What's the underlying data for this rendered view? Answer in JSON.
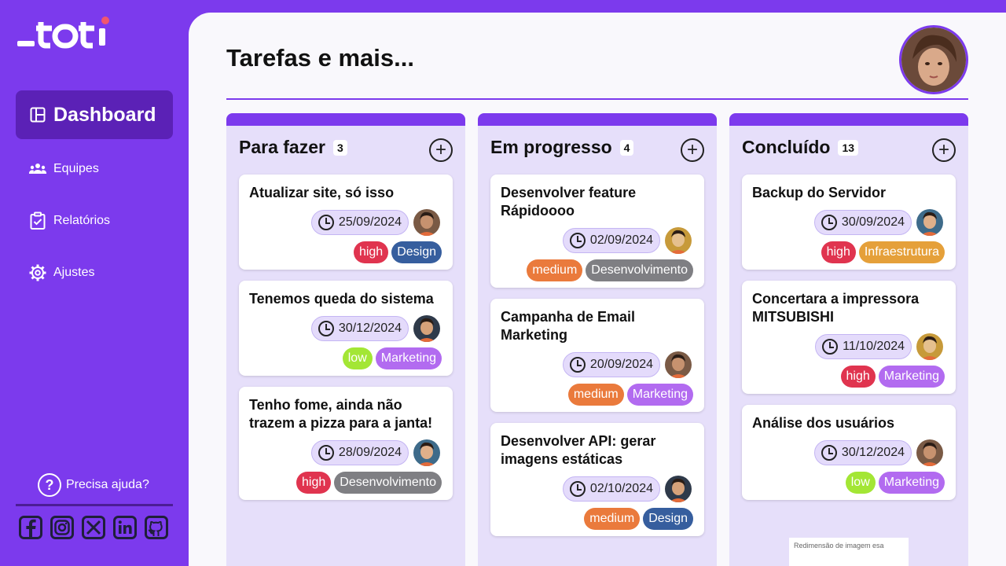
{
  "brand": {
    "logo_text": "_toti"
  },
  "sidebar": {
    "active": {
      "label": "Dashboard",
      "icon": "layout-icon"
    },
    "items": [
      {
        "label": "Equipes",
        "icon": "team-icon"
      },
      {
        "label": "Relatórios",
        "icon": "clipboard-check-icon"
      },
      {
        "label": "Ajustes",
        "icon": "gear-icon"
      }
    ],
    "help_label": "Precisa ajuda?",
    "socials": [
      "facebook-icon",
      "instagram-icon",
      "x-icon",
      "linkedin-icon",
      "github-icon"
    ]
  },
  "header": {
    "title": "Tarefas e mais..."
  },
  "colors": {
    "accent": "#7c3aed",
    "high": "#e0344f",
    "medium": "#ea7a3c",
    "low": "#a3e635",
    "Design": "#365e9e",
    "Marketing": "#b26bf0",
    "Desenvolvimento": "#7f7f83",
    "Infraestrutura": "#e5a03a"
  },
  "columns": [
    {
      "title": "Para fazer",
      "count": "3",
      "cards": [
        {
          "title": "Atualizar site, só isso",
          "date": "25/09/2024",
          "priority": "high",
          "category": "Design"
        },
        {
          "title": "Tenemos queda do sistema",
          "date": "30/12/2024",
          "priority": "low",
          "category": "Marketing"
        },
        {
          "title": "Tenho fome, ainda não trazem a pizza para a janta!",
          "date": "28/09/2024",
          "priority": "high",
          "category": "Desenvolvimento"
        }
      ]
    },
    {
      "title": "Em progresso",
      "count": "4",
      "cards": [
        {
          "title": "Desenvolver feature Rápidoooo",
          "date": "02/09/2024",
          "priority": "medium",
          "category": "Desenvolvimento"
        },
        {
          "title": "Campanha de Email Marketing",
          "date": "20/09/2024",
          "priority": "medium",
          "category": "Marketing"
        },
        {
          "title": "Desenvolver API: gerar imagens estáticas",
          "date": "02/10/2024",
          "priority": "medium",
          "category": "Design"
        }
      ]
    },
    {
      "title": "Concluído",
      "count": "13",
      "cards": [
        {
          "title": "Backup do Servidor",
          "date": "30/09/2024",
          "priority": "high",
          "category": "Infraestrutura"
        },
        {
          "title": "Concertara a impressora MITSUBISHI",
          "date": "11/10/2024",
          "priority": "high",
          "category": "Marketing"
        },
        {
          "title": "Análise dos usuários",
          "date": "30/12/2024",
          "priority": "low",
          "category": "Marketing"
        }
      ]
    }
  ],
  "tooltip": {
    "text": "Redimensão de imagem esa"
  }
}
